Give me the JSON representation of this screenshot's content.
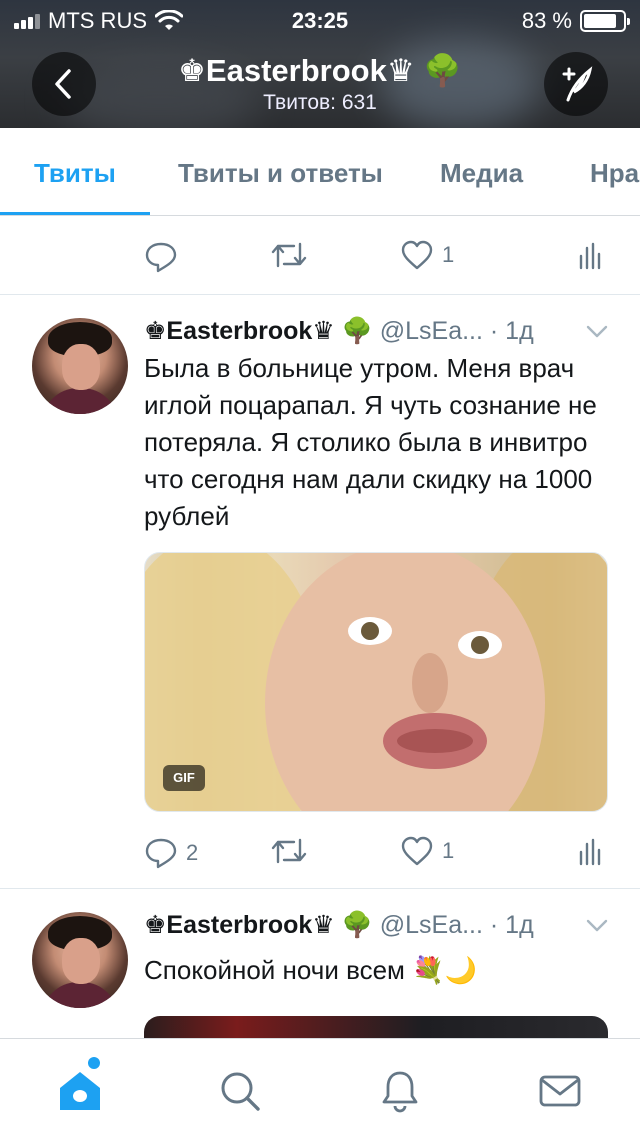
{
  "status_bar": {
    "carrier": "MTS RUS",
    "time": "23:25",
    "battery": "83 %",
    "battery_level": 0.83
  },
  "header": {
    "title": "♚Easterbrook♛ 🌳",
    "tweet_count": "Твитов: 631"
  },
  "tabs": [
    "Твиты",
    "Твиты и ответы",
    "Медиа",
    "Нра"
  ],
  "top_actions": {
    "reply_count": "",
    "retweet_count": "",
    "like_count": "1"
  },
  "tweets": [
    {
      "name": "♚Easterbrook♛ 🌳",
      "handle_time": "@LsEa... · 1д",
      "text": "Была в больнице утром. Меня врач иглой поцарапал. Я чуть сознание не потеряла. Я столико была в инвитро что сегодня нам дали скидку на 1000 рублей",
      "media_badge": "GIF",
      "reply_count": "2",
      "retweet_count": "",
      "like_count": "1"
    },
    {
      "name": "♚Easterbrook♛ 🌳",
      "handle_time": "@LsEa... · 1д",
      "text": "Спокойной ночи  всем 💐🌙"
    }
  ],
  "colors": {
    "accent": "#1da1f2",
    "secondary_text": "#657786"
  },
  "icons": {
    "back": "chevron-left-icon",
    "compose": "compose-feather-icon",
    "reply": "reply-bubble-icon",
    "retweet": "retweet-icon",
    "like": "heart-icon",
    "analytics": "analytics-icon",
    "menu": "chevron-down-icon",
    "home": "home-icon",
    "search": "search-icon",
    "notifications": "bell-icon",
    "messages": "mail-icon"
  }
}
